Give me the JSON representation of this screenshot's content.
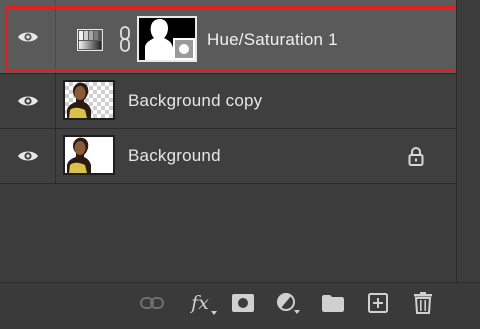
{
  "layers": [
    {
      "name": "Hue/Saturation 1",
      "visible": true,
      "selected": true,
      "type": "adjustment"
    },
    {
      "name": "Background copy",
      "visible": true,
      "selected": false,
      "type": "pixel-transparent"
    },
    {
      "name": "Background",
      "visible": true,
      "selected": false,
      "type": "pixel",
      "locked": true
    }
  ],
  "footer": {
    "tools": [
      "link-layers-icon",
      "fx-icon",
      "add-mask-icon",
      "adjustment-icon",
      "group-folder-icon",
      "new-layer-icon",
      "trash-icon"
    ],
    "fx_label": "fx"
  },
  "colors": {
    "selected_row": "#5a5a5a",
    "row": "#3f3f3f",
    "highlight_border": "#e0201e",
    "icon": "#d0d0d0"
  }
}
